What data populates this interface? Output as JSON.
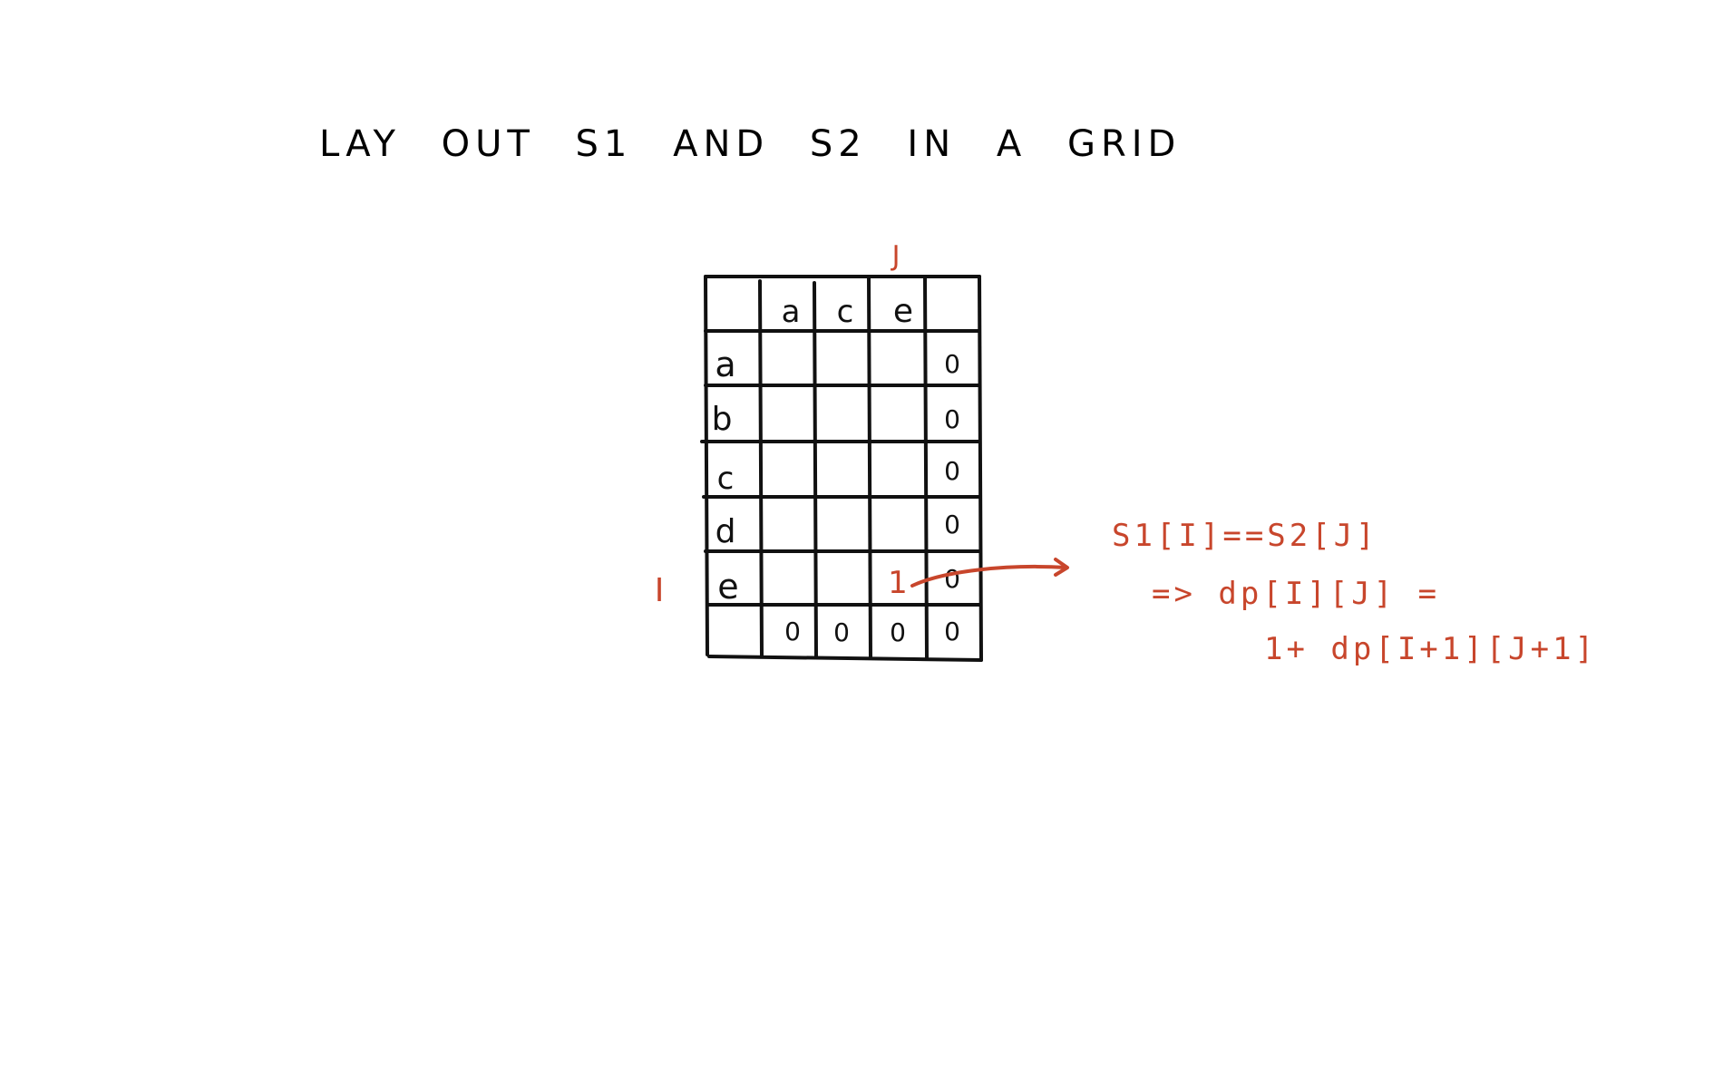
{
  "title": "LAY OUT S1 AND S2 IN A GRID",
  "colors": {
    "ink": "#111111",
    "accent": "#c8462c",
    "background": "#ffffff"
  },
  "grid": {
    "column_index_label": "J",
    "row_index_label": "I",
    "column_headers": [
      "a",
      "c",
      "e"
    ],
    "row_headers": [
      "a",
      "b",
      "c",
      "d",
      "e"
    ],
    "right_column_values": [
      "0",
      "0",
      "0",
      "0",
      "0"
    ],
    "bottom_row_values": [
      "0",
      "0",
      "0",
      "0"
    ],
    "highlight_value": "1"
  },
  "annotation": {
    "line1": "S1[I]==S2[J]",
    "line2": "=> dp[I][J] =",
    "line3": "1+ dp[I+1][J+1]"
  }
}
